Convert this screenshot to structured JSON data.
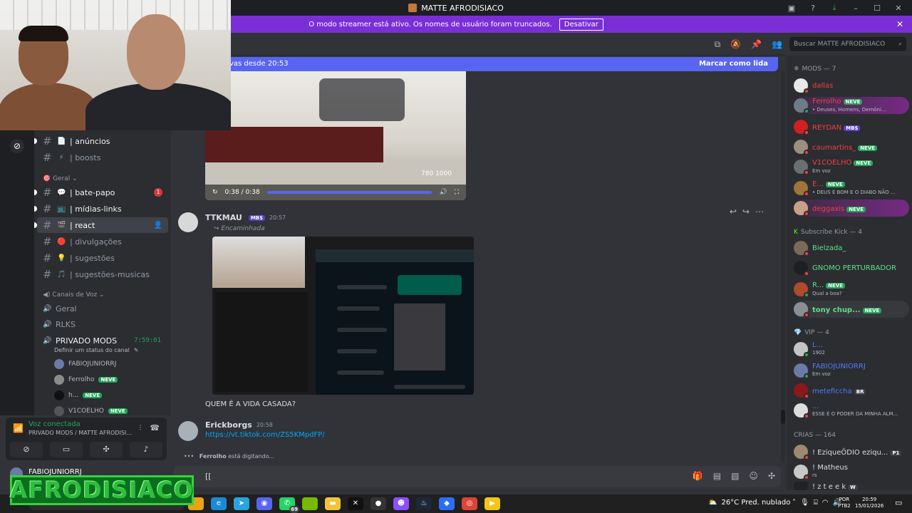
{
  "titlebar": {
    "title": "MATTE AFRODISIACO"
  },
  "banner": {
    "message": "O modo streamer está ativo. Os nomes de usuário foram truncados.",
    "button": "Desativar"
  },
  "header": {
    "search_placeholder": "Buscar MATTE AFRODISIACO"
  },
  "new_messages": {
    "left": "vas desde 20:53",
    "right": "Marcar como lida"
  },
  "channels": [
    {
      "emoji": "📄",
      "name": "| anúncios"
    },
    {
      "emoji": "⚡",
      "name": "| boosts"
    },
    {
      "category": "Geral"
    },
    {
      "emoji": "💬",
      "name": "| bate-papo",
      "badge": "1"
    },
    {
      "emoji": "📺",
      "name": "| mídias-links"
    },
    {
      "emoji": "🎬",
      "name": "| react"
    },
    {
      "emoji": "🔴",
      "name": "| divulgações"
    },
    {
      "emoji": "💡",
      "name": "| sugestões"
    },
    {
      "emoji": "🎵",
      "name": "| sugestões-musicas"
    }
  ],
  "voice": {
    "category": "Canais de Voz",
    "channels": [
      "Geral",
      "RLKS",
      "PRIVADO MODS"
    ],
    "timer": "7:59:01",
    "status_hint": "Definir um status do canal",
    "users": [
      {
        "name": "FABIOJUNIORRJ"
      },
      {
        "name": "Ferrolho",
        "tag": "NEVE"
      },
      {
        "name": "h...",
        "tag": "NEVE"
      },
      {
        "name": "V1COELHO",
        "tag": "NEVE"
      }
    ]
  },
  "voicepanel": {
    "status": "Voz conectada",
    "sub": "PRIVADO MODS / MATTE AFRODISI..."
  },
  "userbar": {
    "name": "FABIOJUNIORRJ"
  },
  "logo_text": "AFRODISIACO",
  "messages": {
    "video_time": "0:38 / 0:38",
    "video_res": "780 1000",
    "msg1": {
      "author": "TTKMAU",
      "tag": "MB$",
      "time": "20:57",
      "forwarded": "Encaminhada"
    },
    "caption": "QUEM É A VIDA CASADA?",
    "msg2": {
      "author": "Erickborgs",
      "time": "20:58",
      "link": "https://vt.tiktok.com/ZS5KMpdFP/"
    },
    "typing_user": "Ferrolho",
    "typing_text": " está digitando..."
  },
  "composer": {
    "text": "[["
  },
  "members": {
    "mods_cat": "MODS — 7",
    "mods": [
      {
        "name": "dallas",
        "color": "#f23f43"
      },
      {
        "name": "Ferrolho",
        "color": "#f23f43",
        "tag": "NEVE",
        "status": "• Deuses, Homens, Demôni..."
      },
      {
        "name": "REYDAN",
        "color": "#f23f43",
        "tag": "MB$"
      },
      {
        "name": "caumartins_",
        "color": "#f23f43",
        "tag": "NEVE"
      },
      {
        "name": "V1COELHO",
        "color": "#f23f43",
        "tag": "NEVE",
        "status": "Em voz"
      },
      {
        "name": "E...",
        "color": "#f23f43",
        "tag": "NEVE",
        "status": "• DEUS É BOM E O DIABO NÃO ..."
      },
      {
        "name": "deggaxis",
        "color": "#f23f43",
        "tag": "NEVE"
      }
    ],
    "kick_cat": "Subscribe Kick — 4",
    "kick": [
      {
        "name": "Bielzada_",
        "color": "#5fe08a"
      },
      {
        "name": "GNOMO PERTURBADOR",
        "color": "#5fe08a"
      },
      {
        "name": "R...",
        "color": "#5fe08a",
        "tag": "NEVE",
        "status": "Qual a boa?"
      },
      {
        "name": "tony chup...",
        "color": "#5fe08a",
        "tag": "NEVE"
      }
    ],
    "vip_cat": "VIP — 4",
    "vip": [
      {
        "name": "L...",
        "color": "#4e7cff",
        "status": "1902"
      },
      {
        "name": "FABIOJUNIORRJ",
        "color": "#4e7cff",
        "status": "Em voz"
      },
      {
        "name": "meteficcha",
        "color": "#4e7cff",
        "tag": "BR"
      },
      {
        "name": "...",
        "color": "#4e7cff",
        "status": "ESSE É O PODER DA MINHA ALM..."
      }
    ],
    "crias_cat": "CRIAS — 164",
    "crias": [
      {
        "name": "! EziqueÔDIO eziqu...",
        "color": "#dbdee1",
        "tag": "P1"
      },
      {
        "name": "! Matheus",
        "color": "#dbdee1",
        "status": "rs"
      },
      {
        "name": "! z t e e k",
        "color": "#dbdee1",
        "tag": "W"
      }
    ]
  },
  "taskbar": {
    "weather": "26°C  Pred. nublado",
    "lang": [
      "POR",
      "PTB2"
    ],
    "clock": [
      "20:59",
      "15/01/2026"
    ],
    "badge_whatsapp": "69"
  }
}
